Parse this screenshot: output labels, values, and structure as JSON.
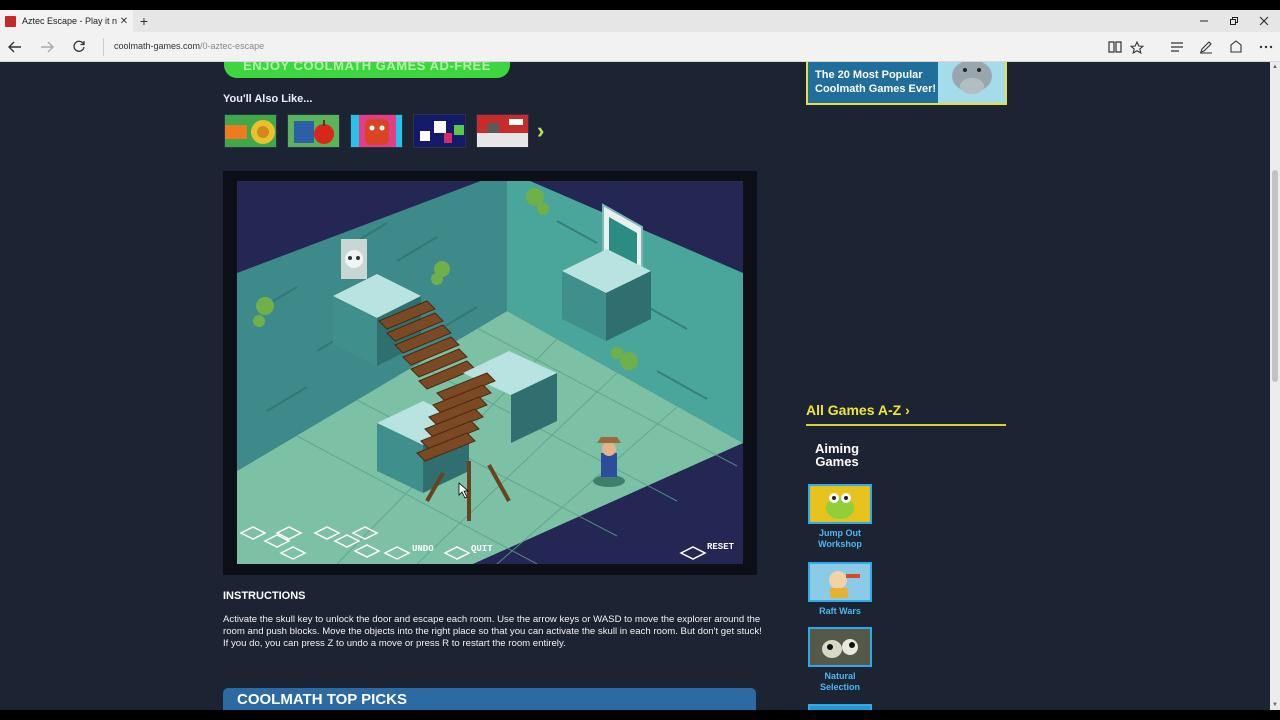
{
  "browser": {
    "tab_title": "Aztec Escape - Play it no",
    "tab_close": "✕",
    "new_tab": "+",
    "url_domain": "coolmath-games.com",
    "url_path": "/0-aztec-escape"
  },
  "page": {
    "adfree_label": "ENJOY COOLMATH GAMES AD-FREE",
    "also_like_heading": "You'll Also Like...",
    "game": {
      "controls": {
        "undo_label": "UNDO",
        "quit_label": "QUIT",
        "reset_label": "RESET"
      }
    },
    "instructions": {
      "title": "INSTRUCTIONS",
      "text": "Activate the skull key to unlock the door and escape each room. Use the arrow keys or WASD to move the explorer around the room and push blocks. Move the objects into the right place so that you can activate the skull in each room. But don't get stuck! If you do, you can press Z to undo a move or press R to restart the room entirely."
    },
    "top_picks_title": "COOLMATH TOP PICKS"
  },
  "sidebar": {
    "popular_card_text": "The 20 Most Popular Coolmath Games Ever!",
    "az_title": "All Games A-Z",
    "category_title": "Aiming Games",
    "games": [
      {
        "label": "Jump Out Workshop"
      },
      {
        "label": "Raft Wars"
      },
      {
        "label": "Natural Selection"
      }
    ]
  },
  "colors": {
    "page_bg": "#1c2333",
    "accent_green": "#3dd640",
    "accent_yellow": "#f2e635",
    "link_blue": "#4ab8f0",
    "top_picks_blue": "#2b6aa3"
  }
}
